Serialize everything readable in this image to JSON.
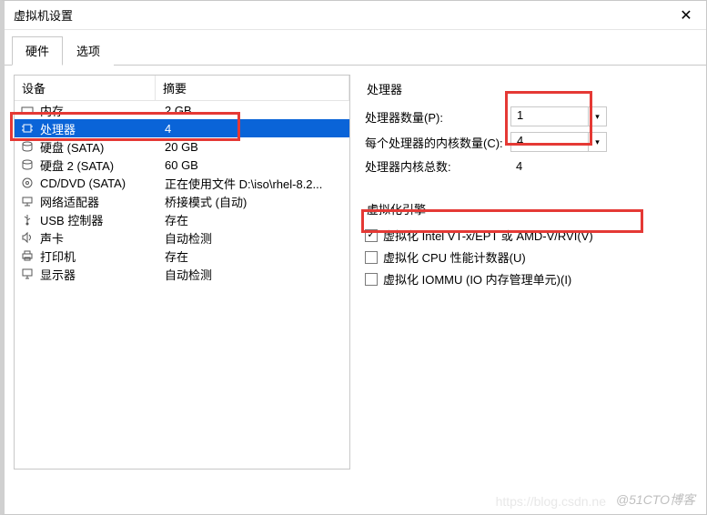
{
  "window": {
    "title": "虚拟机设置"
  },
  "tabs": {
    "hardware": "硬件",
    "options": "选项"
  },
  "table": {
    "col_device": "设备",
    "col_summary": "摘要",
    "rows": [
      {
        "icon": "memory-icon",
        "device": "内存",
        "summary": "2 GB"
      },
      {
        "icon": "cpu-icon",
        "device": "处理器",
        "summary": "4",
        "selected": true
      },
      {
        "icon": "disk-icon",
        "device": "硬盘 (SATA)",
        "summary": "20 GB"
      },
      {
        "icon": "disk-icon",
        "device": "硬盘 2 (SATA)",
        "summary": "60 GB"
      },
      {
        "icon": "cd-icon",
        "device": "CD/DVD (SATA)",
        "summary": "正在使用文件 D:\\iso\\rhel-8.2..."
      },
      {
        "icon": "network-icon",
        "device": "网络适配器",
        "summary": "桥接模式 (自动)"
      },
      {
        "icon": "usb-icon",
        "device": "USB 控制器",
        "summary": "存在"
      },
      {
        "icon": "sound-icon",
        "device": "声卡",
        "summary": "自动检测"
      },
      {
        "icon": "printer-icon",
        "device": "打印机",
        "summary": "存在"
      },
      {
        "icon": "display-icon",
        "device": "显示器",
        "summary": "自动检测"
      }
    ]
  },
  "right": {
    "section1_title": "处理器",
    "proc_count_label": "处理器数量(P):",
    "proc_count_value": "1",
    "cores_per_label": "每个处理器的内核数量(C):",
    "cores_per_value": "4",
    "total_cores_label": "处理器内核总数:",
    "total_cores_value": "4",
    "section2_title": "虚拟化引擎",
    "chk_vtx": "虚拟化 Intel VT-x/EPT 或 AMD-V/RVI(V)",
    "chk_cpu_perf": "虚拟化 CPU 性能计数器(U)",
    "chk_iommu": "虚拟化 IOMMU (IO 内存管理单元)(I)"
  },
  "watermark": "@51CTO博客",
  "watermark2": "https://blog.csdn.ne"
}
